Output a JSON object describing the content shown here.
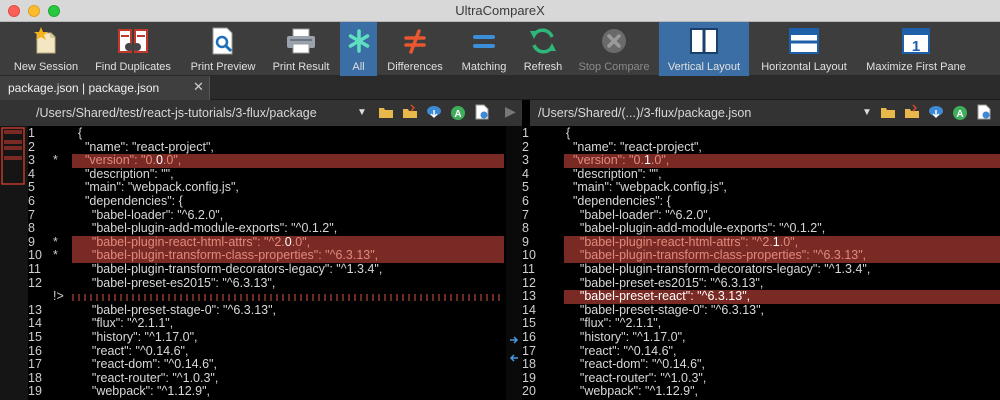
{
  "window": {
    "title": "UltraCompareX"
  },
  "toolbar": {
    "buttons": [
      {
        "label": "New Session",
        "icon": "new-session-icon"
      },
      {
        "label": "Find Duplicates",
        "icon": "find-duplicates-icon"
      },
      {
        "label": "Print Preview",
        "icon": "print-preview-icon"
      },
      {
        "label": "Print Result",
        "icon": "printer-icon"
      },
      {
        "label": "All",
        "icon": "asterisk-icon",
        "active": true
      },
      {
        "label": "Differences",
        "icon": "not-equal-icon"
      },
      {
        "label": "Matching",
        "icon": "equal-icon"
      },
      {
        "label": "Refresh",
        "icon": "refresh-icon"
      },
      {
        "label": "Stop Compare",
        "icon": "stop-icon",
        "disabled": true
      },
      {
        "label": "Vertical Layout",
        "icon": "vertical-layout-icon",
        "active": true
      },
      {
        "label": "Horizontal Layout",
        "icon": "horizontal-layout-icon"
      },
      {
        "label": "Maximize First Pane",
        "icon": "maximize-first-pane-icon"
      }
    ]
  },
  "tabs": [
    {
      "label": "package.json | package.json"
    }
  ],
  "left_pane": {
    "path": "/Users/Shared/test/react-js-tutorials/3-flux/package",
    "lines": [
      {
        "n": "1",
        "m": "",
        "t": "{"
      },
      {
        "n": "2",
        "m": "",
        "t": "  \"name\": \"react-project\","
      },
      {
        "n": "3",
        "m": "*",
        "pre": "  \"version\": \"0.",
        "diff": "0",
        "post": ".0\",",
        "hl": true
      },
      {
        "n": "4",
        "m": "",
        "t": "  \"description\": \"\","
      },
      {
        "n": "5",
        "m": "",
        "t": "  \"main\": \"webpack.config.js\","
      },
      {
        "n": "6",
        "m": "",
        "t": "  \"dependencies\": {"
      },
      {
        "n": "7",
        "m": "",
        "t": "    \"babel-loader\": \"^6.2.0\","
      },
      {
        "n": "8",
        "m": "",
        "t": "    \"babel-plugin-add-module-exports\": \"^0.1.2\","
      },
      {
        "n": "9",
        "m": "*",
        "pre": "    \"babel-plugin-react-html-attrs\": \"^2.",
        "diff": "0",
        "post": ".0\",",
        "hl": true
      },
      {
        "n": "10",
        "m": "*",
        "t": "    \"babel-plugin-transform-class-properties\": \"^6.3.13\",",
        "hl": true
      },
      {
        "n": "11",
        "m": "",
        "t": "    \"babel-plugin-transform-decorators-legacy\": \"^1.3.4\","
      },
      {
        "n": "12",
        "m": "",
        "t": "    \"babel-preset-es2015\": \"^6.3.13\","
      },
      {
        "n": "",
        "m": "!>",
        "t": "",
        "missing": true
      },
      {
        "n": "13",
        "m": "",
        "t": "    \"babel-preset-stage-0\": \"^6.3.13\","
      },
      {
        "n": "14",
        "m": "",
        "t": "    \"flux\": \"^2.1.1\","
      },
      {
        "n": "15",
        "m": "",
        "t": "    \"history\": \"^1.17.0\","
      },
      {
        "n": "16",
        "m": "",
        "t": "    \"react\": \"^0.14.6\","
      },
      {
        "n": "17",
        "m": "",
        "t": "    \"react-dom\": \"^0.14.6\","
      },
      {
        "n": "18",
        "m": "",
        "t": "    \"react-router\": \"^1.0.3\","
      },
      {
        "n": "19",
        "m": "",
        "t": "    \"webpack\": \"^1.12.9\","
      }
    ]
  },
  "right_pane": {
    "path": "/Users/Shared/(...)/3-flux/package.json",
    "lines": [
      {
        "n": "1",
        "t": "{"
      },
      {
        "n": "2",
        "t": "  \"name\": \"react-project\","
      },
      {
        "n": "3",
        "pre": "  \"version\": \"0.",
        "diff": "1",
        "post": ".0\",",
        "hl": true
      },
      {
        "n": "4",
        "t": "  \"description\": \"\","
      },
      {
        "n": "5",
        "t": "  \"main\": \"webpack.config.js\","
      },
      {
        "n": "6",
        "t": "  \"dependencies\": {"
      },
      {
        "n": "7",
        "t": "    \"babel-loader\": \"^6.2.0\","
      },
      {
        "n": "8",
        "t": "    \"babel-plugin-add-module-exports\": \"^0.1.2\","
      },
      {
        "n": "9",
        "pre": "    \"babel-plugin-react-html-attrs\": \"^2.",
        "diff": "1",
        "post": ".0\",",
        "hl": true
      },
      {
        "n": "10",
        "t": "    \"babel-plugin-transform-class-properties\": \"^6.3.13\",",
        "hl": true
      },
      {
        "n": "11",
        "t": "    \"babel-plugin-transform-decorators-legacy\": \"^1.3.4\","
      },
      {
        "n": "12",
        "t": "    \"babel-preset-es2015\": \"^6.3.13\","
      },
      {
        "n": "13",
        "t": "    \"babel-preset-react\": \"^6.3.13\",",
        "hl": true,
        "bright": true
      },
      {
        "n": "14",
        "t": "    \"babel-preset-stage-0\": \"^6.3.13\","
      },
      {
        "n": "15",
        "t": "    \"flux\": \"^2.1.1\","
      },
      {
        "n": "16",
        "t": "    \"history\": \"^1.17.0\","
      },
      {
        "n": "17",
        "t": "    \"react\": \"^0.14.6\","
      },
      {
        "n": "18",
        "t": "    \"react-dom\": \"^0.14.6\","
      },
      {
        "n": "19",
        "t": "    \"react-router\": \"^1.0.3\","
      },
      {
        "n": "20",
        "t": "    \"webpack\": \"^1.12.9\","
      }
    ]
  },
  "colors": {
    "diff_highlight": "#7a2a24",
    "toolbar_active": "#3a6ea5"
  }
}
